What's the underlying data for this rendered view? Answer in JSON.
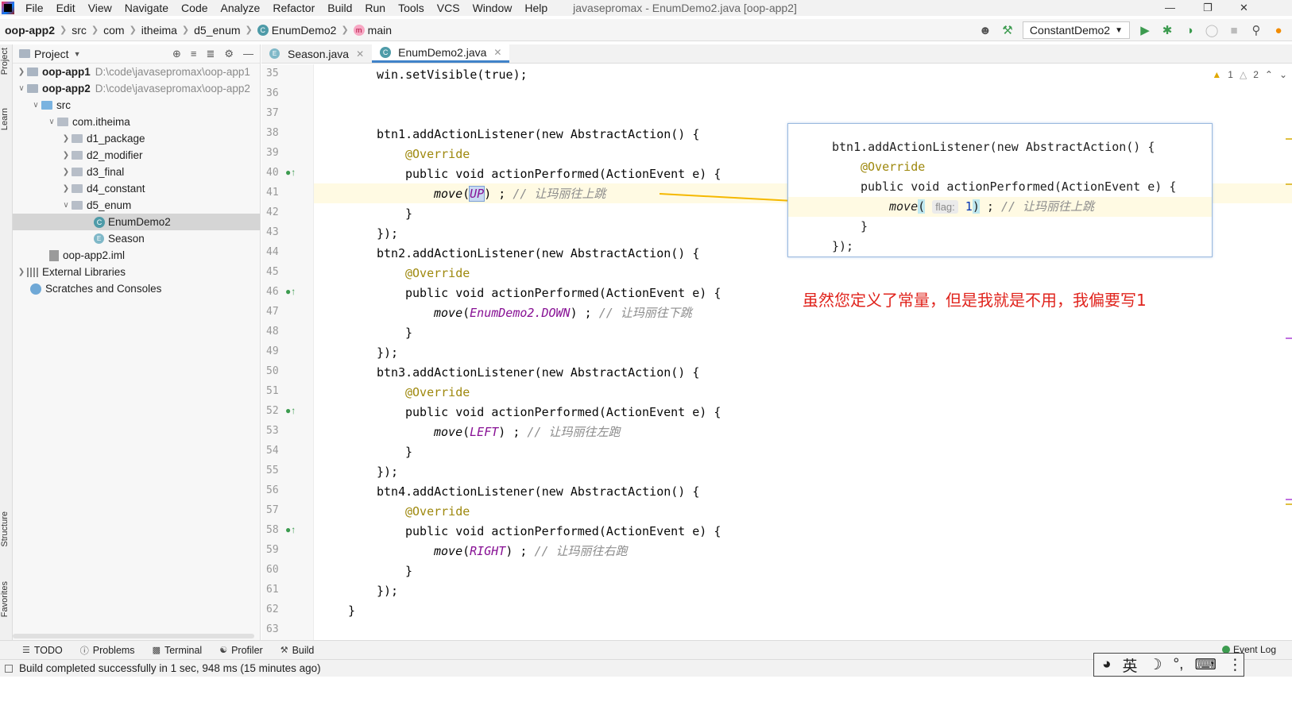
{
  "menubar": {
    "items": [
      "File",
      "Edit",
      "View",
      "Navigate",
      "Code",
      "Analyze",
      "Refactor",
      "Build",
      "Run",
      "Tools",
      "VCS",
      "Window",
      "Help"
    ],
    "window_title": "javasepromax - EnumDemo2.java [oop-app2]"
  },
  "navbar": {
    "crumbs": [
      "oop-app2",
      "src",
      "com",
      "itheima",
      "d5_enum",
      "EnumDemo2",
      "main"
    ],
    "run_config": "ConstantDemo2"
  },
  "left_stripe": {
    "project": "Project",
    "learn": "Learn",
    "structure": "Structure",
    "favorites": "Favorites"
  },
  "project_panel": {
    "title": "Project",
    "tree": [
      {
        "label": "oop-app1",
        "path": "D:\\code\\javasepromax\\oop-app1"
      },
      {
        "label": "oop-app2",
        "path": "D:\\code\\javasepromax\\oop-app2"
      },
      {
        "label": "src"
      },
      {
        "label": "com.itheima"
      },
      {
        "label": "d1_package"
      },
      {
        "label": "d2_modifier"
      },
      {
        "label": "d3_final"
      },
      {
        "label": "d4_constant"
      },
      {
        "label": "d5_enum"
      },
      {
        "label": "EnumDemo2"
      },
      {
        "label": "Season"
      },
      {
        "label": "oop-app2.iml"
      },
      {
        "label": "External Libraries"
      },
      {
        "label": "Scratches and Consoles"
      }
    ]
  },
  "tabs": [
    {
      "label": "Season.java"
    },
    {
      "label": "EnumDemo2.java"
    }
  ],
  "editor": {
    "line_numbers": [
      "35",
      "36",
      "37",
      "38",
      "39",
      "40",
      "41",
      "42",
      "43",
      "44",
      "45",
      "46",
      "47",
      "48",
      "49",
      "50",
      "51",
      "52",
      "53",
      "54",
      "55",
      "56",
      "57",
      "58",
      "59",
      "60",
      "61",
      "62",
      "63"
    ],
    "warnings_yellow": "1",
    "warnings_gray": "2",
    "code": {
      "l35": "win.setVisible(true);",
      "btn1": "btn1.addActionListener(new AbstractAction() {",
      "btn2": "btn2.addActionListener(new AbstractAction() {",
      "btn3": "btn3.addActionListener(new AbstractAction() {",
      "btn4": "btn4.addActionListener(new AbstractAction() {",
      "override": "@Override",
      "method_sig": "public void actionPerformed(ActionEvent e) {",
      "move_up_arg": "UP",
      "move_down_arg": "EnumDemo2.DOWN",
      "move_left_arg": "LEFT",
      "move_right_arg": "RIGHT",
      "cm_up": "// 让玛丽往上跳",
      "cm_down": "// 让玛丽往下跳",
      "cm_left": "// 让玛丽往左跑",
      "cm_right": "// 让玛丽往右跑",
      "close_brace": "}",
      "close_paren": "});"
    }
  },
  "popup": {
    "line1": "btn1.addActionListener(new AbstractAction() {",
    "line2": "@Override",
    "line3": "public void actionPerformed(ActionEvent e) {",
    "param_hint": "flag:",
    "arg": "1",
    "comment": "// 让玛丽往上跳",
    "line5": "}",
    "line6": "});"
  },
  "annotation": "虽然您定义了常量，但是我就是不用，我偏要写1",
  "bottom_tools": [
    "TODO",
    "Problems",
    "Terminal",
    "Profiler",
    "Build"
  ],
  "event_log": "Event Log",
  "status": "Build completed successfully in 1 sec, 948 ms (15 minutes ago)",
  "ime": {
    "lang": "英"
  },
  "colors": {
    "keyword": "#0033b3",
    "annotation": "#9e880d",
    "function": "#00627a",
    "constant": "#871094",
    "comment": "#8c8c8c",
    "note_red": "#e0241d",
    "arrow": "#f5b800"
  }
}
